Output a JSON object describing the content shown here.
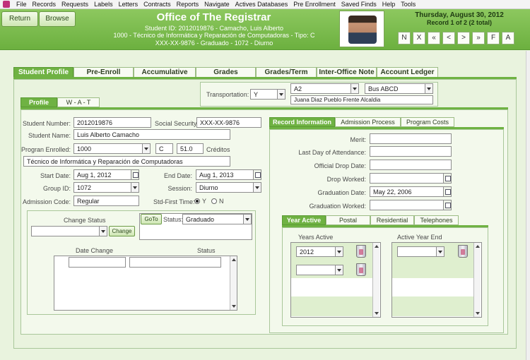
{
  "menu": [
    "File",
    "Records",
    "Requests",
    "Labels",
    "Letters",
    "Contracts",
    "Reports",
    "Navigate",
    "Actives Databases",
    "Pre Enrollment",
    "Saved Finds",
    "Help",
    "Tools"
  ],
  "header": {
    "return_label": "Return",
    "browse_label": "Browse",
    "title": "Office of The Registrar",
    "line1": "Student ID: 2012019876 - Camacho, Luis Alberto",
    "line2": "1000 - Técnico de Informática y Reparación de Computadoras - Tipo: C",
    "line3": "XXX-XX-9876 - Graduado - 1072 - Diurno",
    "date": "Thursday, August 30, 2012",
    "record": "Record 1 of 2 (2 total)",
    "nav": [
      "N",
      "X",
      "«",
      "<",
      ">",
      "»",
      "F",
      "A"
    ]
  },
  "main_tabs": [
    "Student Profile",
    "Pre-Enroll",
    "Accumulative",
    "Grades",
    "Grades/Term",
    "Inter-Office Note",
    "Account Ledger"
  ],
  "transport": {
    "label": "Transportation:",
    "value": "Y",
    "zone": "A2",
    "bus": "Bus ABCD",
    "address": "Juana Diaz Pueblo Frente Alcaldia"
  },
  "profile_tabs": [
    "Profile",
    "W - A - T"
  ],
  "profile": {
    "student_number_label": "Student Number:",
    "student_number": "2012019876",
    "ssn_label": "Social Security:",
    "ssn": "XXX-XX-9876",
    "name_label": "Student Name:",
    "name": "Luis Alberto Camacho",
    "program_label": "Progran Enrolled:",
    "program": "1000",
    "tipo": "C",
    "credits": "51.0",
    "credits_label": "Créditos",
    "program_desc": "Técnico de Informática y Reparación de Computadoras",
    "start_label": "Start Date:",
    "start": "Aug 1, 2012",
    "end_label": "End Date:",
    "end": "Aug 1, 2013",
    "group_label": "Group ID:",
    "group": "1072",
    "session_label": "Session:",
    "session": "Diurno",
    "admission_label": "Admission Code:",
    "admission": "Regular",
    "stdfirst_label": "Std-First Time:",
    "yes": "Y",
    "no": "N"
  },
  "status_box": {
    "change_status_label": "Change Status",
    "change_button": "Change",
    "goto_button": "GoTo",
    "status_label": "Status:",
    "status": "Graduado",
    "date_change_header": "Date Change",
    "status_header": "Status"
  },
  "record_tabs": [
    "Record Information",
    "Admission Process",
    "Program Costs"
  ],
  "record": {
    "merit_label": "Merit:",
    "last_day_label": "Last Day of Attendance:",
    "official_drop_label": "Official Drop Date:",
    "drop_worked_label": "Drop Worked:",
    "graduation_date_label": "Graduation Date:",
    "graduation_date": "May 22, 2006",
    "graduation_worked_label": "Graduation Worked:"
  },
  "year_tabs": [
    "Year Active",
    "Postal",
    "Residential",
    "Telephones"
  ],
  "years": {
    "years_active_header": "Years Active",
    "active_year_end_header": "Active Year End",
    "year_value": "2012"
  }
}
